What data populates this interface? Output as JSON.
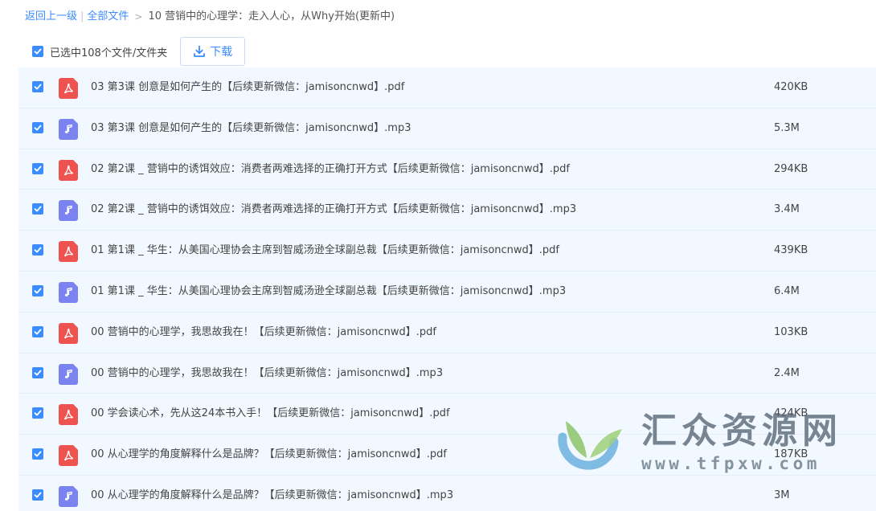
{
  "breadcrumb": {
    "back_label": "返回上一级",
    "separator": "|",
    "all_files_label": "全部文件",
    "arrow": ">",
    "current_folder": "10 营销中的心理学：走入人心，从Why开始(更新中)"
  },
  "toolbar": {
    "selection_text": "已选中108个文件/文件夹",
    "download_label": "下载"
  },
  "files": [
    {
      "type": "pdf",
      "icon": "pdf-file-icon",
      "name": "03 第3课 创意是如何产生的【后续更新微信：jamisoncnwd】.pdf",
      "size": "420KB",
      "checked": true
    },
    {
      "type": "mp3",
      "icon": "audio-file-icon",
      "name": "03 第3课 创意是如何产生的【后续更新微信：jamisoncnwd】.mp3",
      "size": "5.3M",
      "checked": true
    },
    {
      "type": "pdf",
      "icon": "pdf-file-icon",
      "name": "02 第2课 _ 营销中的诱饵效应：消费者两难选择的正确打开方式【后续更新微信：jamisoncnwd】.pdf",
      "size": "294KB",
      "checked": true
    },
    {
      "type": "mp3",
      "icon": "audio-file-icon",
      "name": "02 第2课 _ 营销中的诱饵效应：消费者两难选择的正确打开方式【后续更新微信：jamisoncnwd】.mp3",
      "size": "3.4M",
      "checked": true
    },
    {
      "type": "pdf",
      "icon": "pdf-file-icon",
      "name": "01 第1课 _ 华生：从美国心理协会主席到智威汤逊全球副总裁【后续更新微信：jamisoncnwd】.pdf",
      "size": "439KB",
      "checked": true
    },
    {
      "type": "mp3",
      "icon": "audio-file-icon",
      "name": "01 第1课 _ 华生：从美国心理协会主席到智威汤逊全球副总裁【后续更新微信：jamisoncnwd】.mp3",
      "size": "6.4M",
      "checked": true
    },
    {
      "type": "pdf",
      "icon": "pdf-file-icon",
      "name": "00 营销中的心理学，我思故我在！【后续更新微信：jamisoncnwd】.pdf",
      "size": "103KB",
      "checked": true
    },
    {
      "type": "mp3",
      "icon": "audio-file-icon",
      "name": "00 营销中的心理学，我思故我在！【后续更新微信：jamisoncnwd】.mp3",
      "size": "2.4M",
      "checked": true
    },
    {
      "type": "pdf",
      "icon": "pdf-file-icon",
      "name": "00 学会读心术，先从这24本书入手！【后续更新微信：jamisoncnwd】.pdf",
      "size": "424KB",
      "checked": true
    },
    {
      "type": "pdf",
      "icon": "pdf-file-icon",
      "name": "00 从心理学的角度解释什么是品牌？【后续更新微信：jamisoncnwd】.pdf",
      "size": "187KB",
      "checked": true
    },
    {
      "type": "mp3",
      "icon": "audio-file-icon",
      "name": "00 从心理学的角度解释什么是品牌？【后续更新微信：jamisoncnwd】.mp3",
      "size": "3M",
      "checked": true
    }
  ],
  "watermark": {
    "title": "汇众资源网",
    "url": "www.tfpxw.com"
  },
  "colors": {
    "accent": "#3b8cff",
    "pdf_icon": "#ef5350",
    "audio_icon": "#7b83f0",
    "row_background": "#f2f8ff"
  }
}
